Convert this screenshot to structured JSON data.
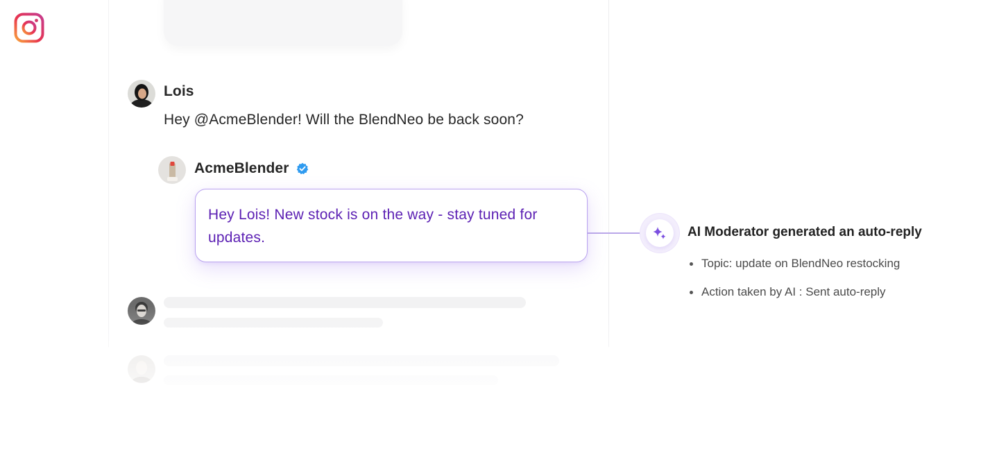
{
  "app": {
    "logo_icon": "instagram-icon"
  },
  "comment": {
    "author": "Lois",
    "text": "Hey @AcmeBlender! Will the BlendNeo be back soon?"
  },
  "reply": {
    "author": "AcmeBlender",
    "verified_icon": "verified-badge-icon",
    "text": "Hey Lois! New stock is on the way - stay tuned for updates."
  },
  "ai_moderator": {
    "icon": "sparkle-icon",
    "title": "AI Moderator generated an auto-reply",
    "details": [
      "Topic: update on BlendNeo restocking",
      "Action taken by AI : Sent auto-reply"
    ]
  },
  "colors": {
    "reply_text": "#5b1fb3",
    "reply_border": "#b9a2ef",
    "verified": "#2f9bf0",
    "sparkle": "#7b4fe0"
  }
}
